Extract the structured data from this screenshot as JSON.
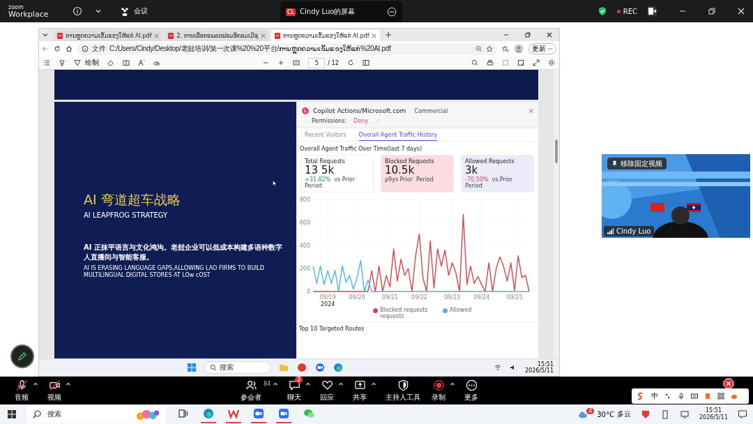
{
  "zoom_bar": {
    "logo_top": "zoom",
    "logo_bottom": "Workplace",
    "meeting_label": "会议",
    "share_tab": {
      "avatar": "CL",
      "title": "Cindy Luo的屏幕"
    },
    "rec_label": "REC"
  },
  "browser": {
    "tabs": [
      {
        "title": "ການຫຼຸດຄວາມເຂັ້ມແຂງໃຫ້ແກ່ AI.pdf",
        "selected": false
      },
      {
        "title": "2. ການເລືອກແພລດຟອມອີຄອມເມີຊ",
        "selected": false
      },
      {
        "title": "ການຫຼຸດຄວາມເຂັ້ມແຂງໃຫ້ແກ່ AI.pdf",
        "selected": true
      }
    ],
    "address_prefix": "文件",
    "address": "C:/Users/Cindy/Desktop/老挝培训/第一次课%20%20平台/ການຫຼຸດຄວາມເຂັ້ມແຂງໃຫ້ແກ່%20AI.pdf",
    "update_button": "更新",
    "pdf_toolbar": {
      "draw_label": "绘制",
      "page": "5",
      "page_total": "/ 12"
    }
  },
  "slide": {
    "title": "AI 弯道超车战略",
    "subtitle": "AI LEAPFROG STRATEGY",
    "body_zh": "AI 正抹平语言与文化鸿沟。老挝企业可以低成本构建多语种数字人直播间与智能客服。",
    "body_en": "AI IS ERASING LANGUAGE GAPS,ALLOWING LAO FIRMS TO BUILD MULTILINGUAL DIGITAL STORES AT LOw cOST"
  },
  "dashboard": {
    "avatar": "L",
    "site": "Copilot Actions/Microsoft.com",
    "plan": "Commercial",
    "permissions_label": "Permissions:",
    "permission_value": "Deny",
    "tabs": [
      {
        "label": "Recent  Visitors",
        "selected": false
      },
      {
        "label": "Overall Agent Traffic History",
        "selected": true
      }
    ],
    "section_title": "Overall Agent Traffic Over Time(last 7 days)",
    "cards": [
      {
        "title": "Total Requests",
        "value": "13 5k",
        "change": "+31.82%",
        "note": "vs Prior",
        "period": "Period",
        "color": "#ffffff"
      },
      {
        "title": "Blocked Requests",
        "value": "10.5k",
        "note": "ρ9ys Prior",
        "period": "Period",
        "color": "#fbdde1"
      },
      {
        "title": "Allowed Requests",
        "value": "3k",
        "change": "-70.50%",
        "note": "vs.Prior",
        "period": "Period",
        "color": "#ecebfa"
      }
    ],
    "chart_data": {
      "type": "line",
      "categories": [
        null,
        null,
        null,
        null,
        "09/19",
        null,
        null,
        null,
        null,
        null,
        null,
        null,
        "09/20",
        null,
        null,
        null,
        null,
        null,
        null,
        null,
        null,
        "09/21",
        null,
        null,
        null,
        null,
        null,
        null,
        null,
        "09/22",
        null,
        null,
        null,
        null,
        null,
        null,
        null,
        null,
        "09/23",
        null,
        null,
        null,
        null,
        null,
        null,
        null,
        "09/24",
        null,
        null,
        null,
        null,
        null,
        null,
        null,
        null,
        "09/25",
        null,
        null,
        null,
        null
      ],
      "ylim": [
        0,
        800
      ],
      "yticks": [
        0,
        200,
        400,
        600,
        800
      ],
      "grid": true,
      "annotations": [
        "2024"
      ],
      "series": [
        {
          "name": "Blocked requests requests",
          "color": "#d9434f",
          "values": [
            0,
            0,
            0,
            0,
            0,
            0,
            0,
            0,
            0,
            0,
            0,
            0,
            0,
            0,
            0,
            0,
            180,
            0,
            220,
            0,
            140,
            40,
            370,
            90,
            280,
            140,
            200,
            0,
            310,
            500,
            120,
            0,
            440,
            30,
            370,
            220,
            360,
            140,
            250,
            160,
            0,
            670,
            60,
            220,
            70,
            130,
            60,
            0,
            250,
            0,
            200,
            300,
            220,
            90,
            250,
            10,
            310,
            120,
            140,
            0
          ]
        },
        {
          "name": "Allowed",
          "color": "#4fb3e8",
          "values": [
            220,
            70,
            220,
            60,
            180,
            70,
            185,
            0,
            225,
            80,
            140,
            20,
            120,
            270,
            0,
            100,
            0,
            0,
            0,
            0,
            0,
            0,
            0,
            0,
            0,
            0,
            0,
            0,
            0,
            0,
            0,
            0,
            0,
            0,
            0,
            0,
            0,
            0,
            0,
            0,
            0,
            0,
            0,
            0,
            0,
            0,
            0,
            0,
            0,
            0,
            0,
            0,
            0,
            0,
            0,
            0,
            0,
            0,
            0,
            0
          ]
        }
      ]
    },
    "routes_title": "Top 10 Targeted Routes"
  },
  "inner_taskbar": {
    "search": "搜索",
    "time": "15:51",
    "date": "2026/5/11"
  },
  "video": {
    "unpin_button": "移除固定视频",
    "name": "Cindy Luo"
  },
  "controls": [
    {
      "kind": "mic",
      "label": "音频",
      "muted": true,
      "caret": true
    },
    {
      "kind": "video",
      "label": "视频",
      "muted": true,
      "caret": true
    },
    {
      "kind": "participants",
      "label": "参会者",
      "count": "84",
      "caret": true
    },
    {
      "kind": "chat",
      "label": "聊天",
      "badge": "2",
      "caret": true
    },
    {
      "kind": "react",
      "label": "回应",
      "caret": true
    },
    {
      "kind": "share",
      "label": "共享",
      "caret": true
    },
    {
      "kind": "host",
      "label": "主持人工具",
      "caret": false
    },
    {
      "kind": "record",
      "label": "录制",
      "caret": true
    },
    {
      "kind": "more",
      "label": "更多",
      "caret": false
    }
  ],
  "ime": {
    "mode": "中"
  },
  "taskbar": {
    "search": "搜索",
    "apps": [
      {
        "kind": "taskview",
        "running": false
      },
      {
        "kind": "edge",
        "running": true
      },
      {
        "kind": "wps",
        "running": true
      },
      {
        "kind": "zoom",
        "running": true
      },
      {
        "kind": "zoom",
        "running": true
      },
      {
        "kind": "wechat",
        "running": false
      }
    ],
    "weather_badge": "4",
    "temperature": "30°C",
    "weather": "多云",
    "time": "15:51",
    "date": "2026/5/11"
  }
}
